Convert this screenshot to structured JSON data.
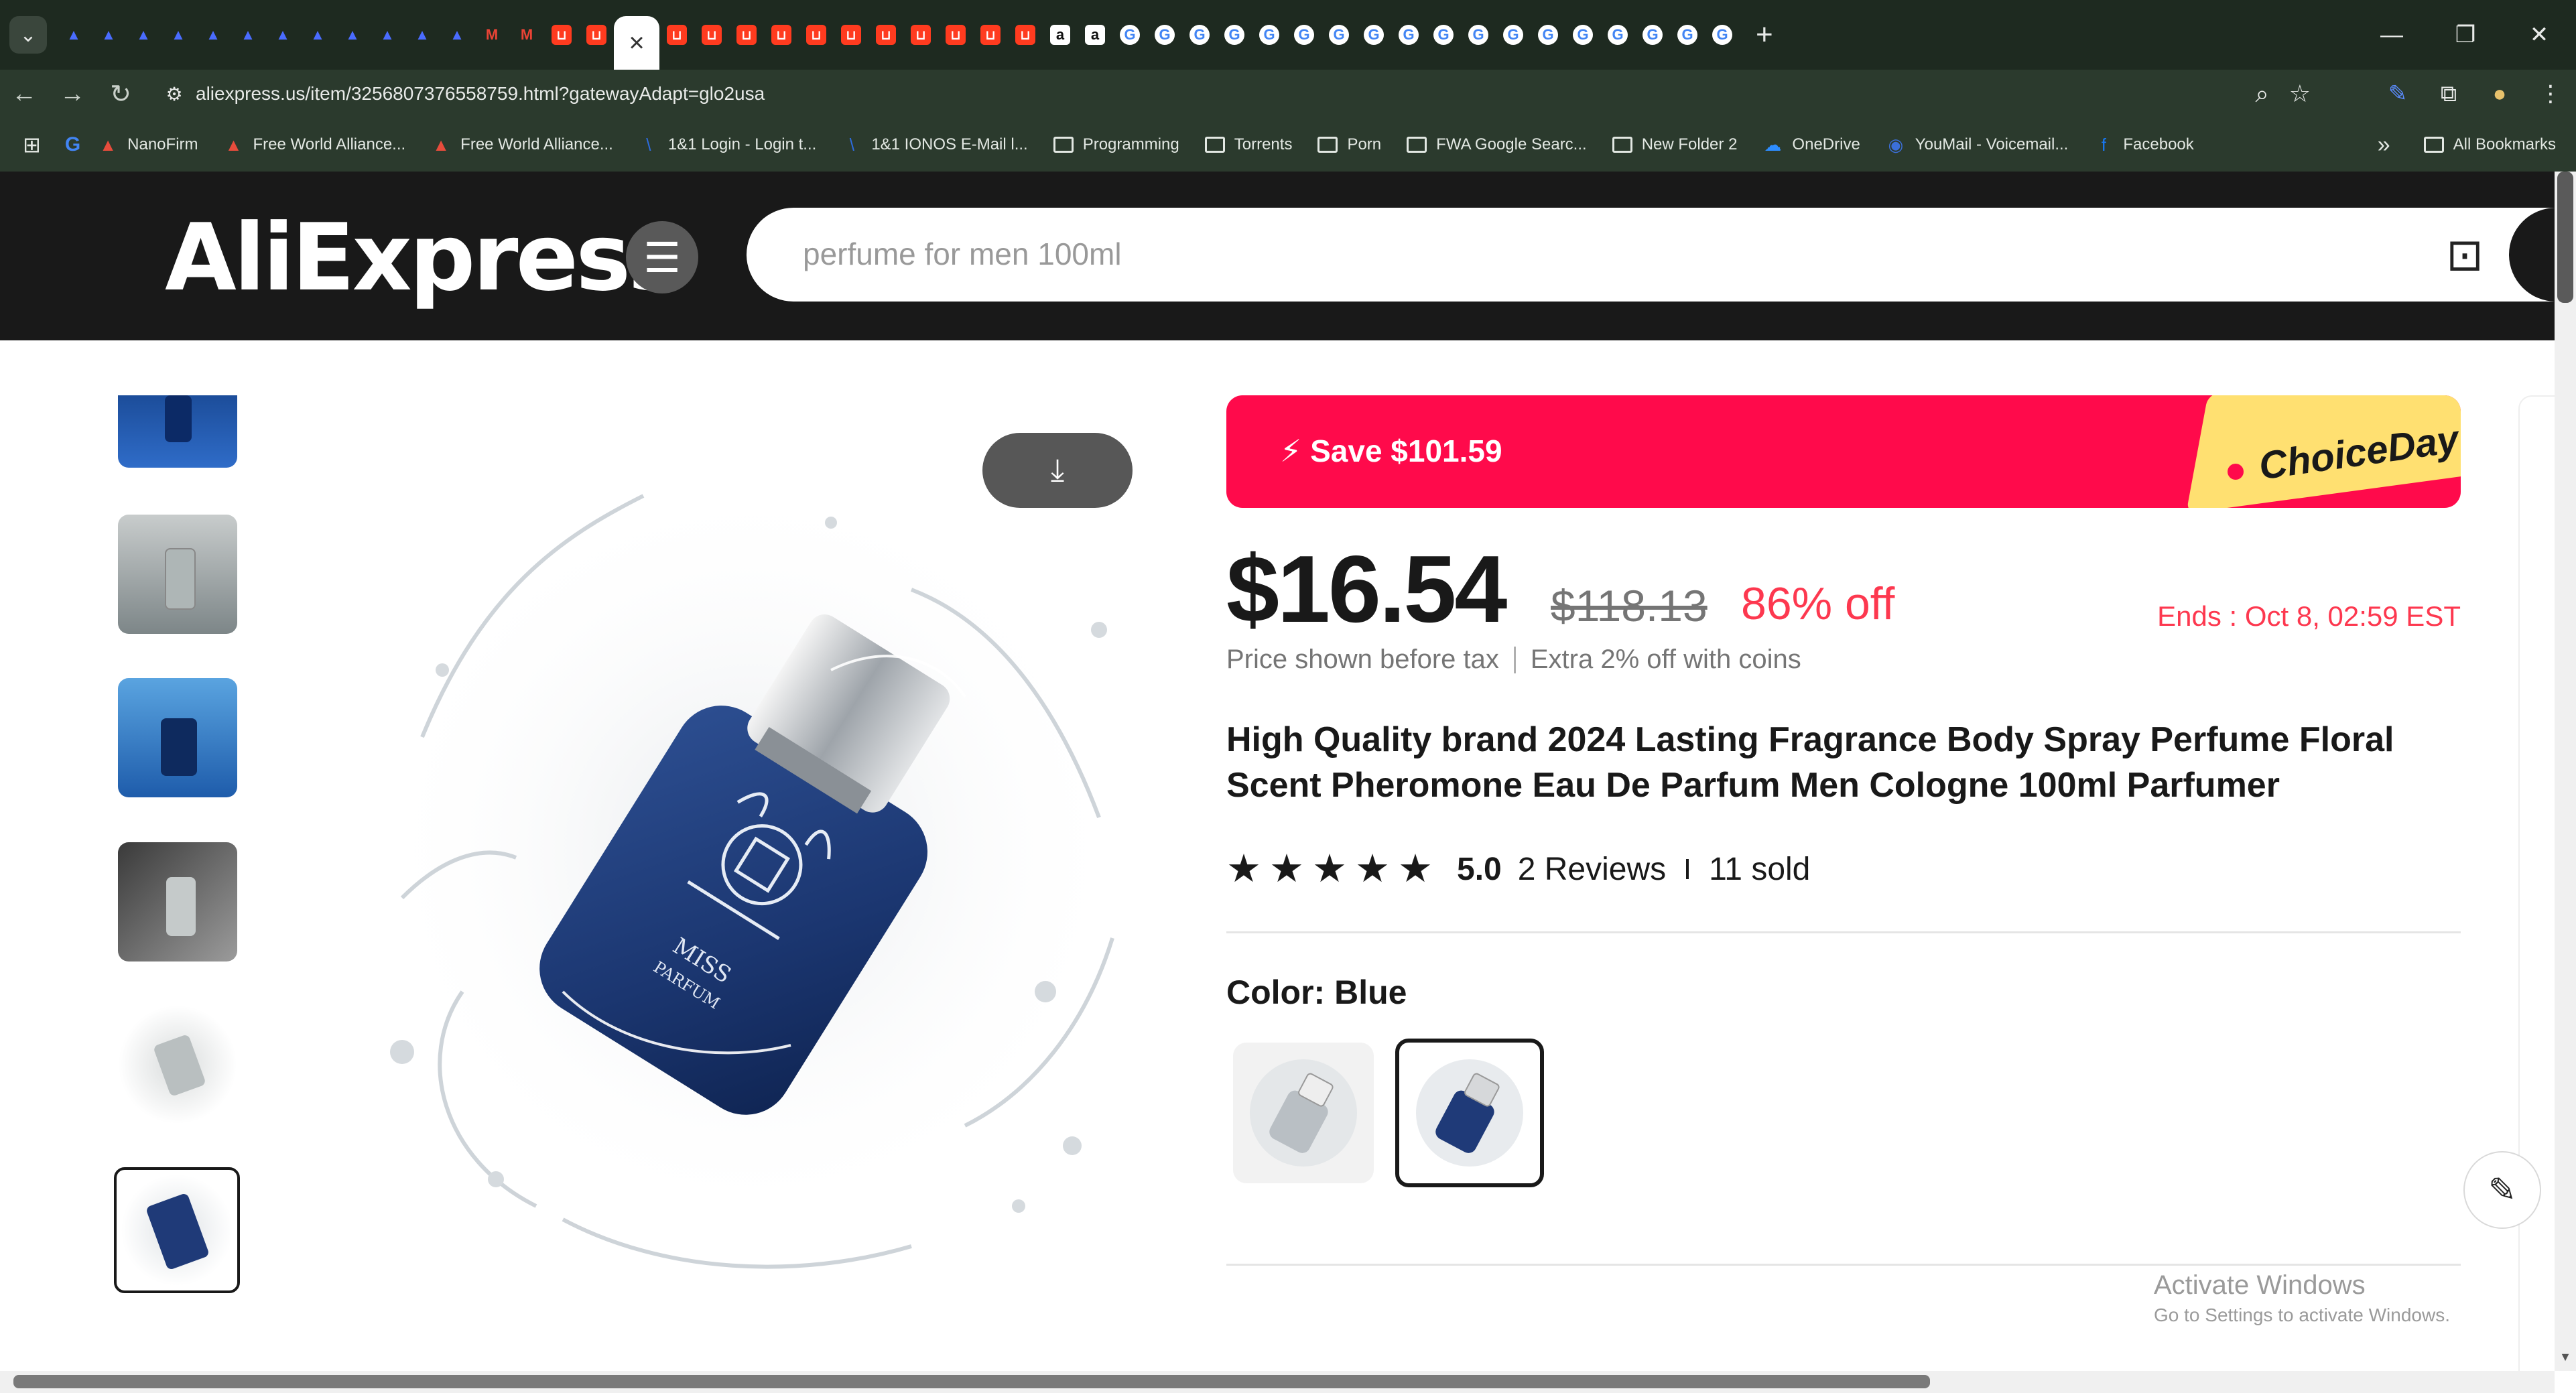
{
  "browser": {
    "tab_count_label": "",
    "new_tab": "+",
    "active_tab_close": "×",
    "url": "aliexpress.us/item/3256807376558759.html?gatewayAdapt=glo2usa",
    "window": {
      "minimize": "—",
      "restore": "❐",
      "close": "✕"
    },
    "tabs": [
      {
        "icon": "ali-blue-icon",
        "color": "#4a6cff"
      },
      {
        "icon": "ali-blue-icon",
        "color": "#4a6cff"
      },
      {
        "icon": "ali-blue-icon",
        "color": "#4a6cff"
      },
      {
        "icon": "ali-blue-icon",
        "color": "#4a6cff"
      },
      {
        "icon": "ali-blue-icon",
        "color": "#4a6cff"
      },
      {
        "icon": "ali-blue-icon",
        "color": "#4a6cff"
      },
      {
        "icon": "ali-blue-icon",
        "color": "#4a6cff"
      },
      {
        "icon": "ali-blue-icon",
        "color": "#4a6cff"
      },
      {
        "icon": "ali-blue-icon",
        "color": "#4a6cff"
      },
      {
        "icon": "ali-blue-icon",
        "color": "#4a6cff"
      },
      {
        "icon": "ali-blue-icon",
        "color": "#4a6cff"
      },
      {
        "icon": "ali-blue-icon",
        "color": "#4a6cff"
      },
      {
        "icon": "gmail-icon",
        "color": "#ea4335"
      },
      {
        "icon": "gmail-icon",
        "color": "#ea4335"
      },
      {
        "icon": "ali-red-icon",
        "color": "#ff3b1f"
      },
      {
        "icon": "ali-red-icon",
        "color": "#ff3b1f"
      },
      {
        "icon": "ali-red-icon",
        "color": "#ff3b1f"
      },
      {
        "icon": "ali-red-icon",
        "color": "#ff3b1f"
      },
      {
        "icon": "ali-red-icon",
        "color": "#ff3b1f"
      },
      {
        "icon": "ali-red-icon",
        "color": "#ff3b1f"
      },
      {
        "icon": "ali-red-icon",
        "color": "#ff3b1f"
      },
      {
        "icon": "ali-red-icon",
        "color": "#ff3b1f"
      },
      {
        "icon": "ali-red-icon",
        "color": "#ff3b1f"
      },
      {
        "icon": "ali-red-icon",
        "color": "#ff3b1f"
      },
      {
        "icon": "ali-red-icon",
        "color": "#ff3b1f"
      },
      {
        "icon": "ali-red-icon",
        "color": "#ff3b1f"
      },
      {
        "icon": "ali-red-icon",
        "color": "#ff3b1f"
      },
      {
        "icon": "amazon-icon",
        "color": "#ffffff"
      },
      {
        "icon": "amazon-icon",
        "color": "#ffffff"
      },
      {
        "icon": "google-icon",
        "color": "#4285f4"
      },
      {
        "icon": "google-icon",
        "color": "#4285f4"
      },
      {
        "icon": "google-icon",
        "color": "#4285f4"
      },
      {
        "icon": "google-icon",
        "color": "#4285f4"
      },
      {
        "icon": "google-icon",
        "color": "#4285f4"
      },
      {
        "icon": "google-icon",
        "color": "#4285f4"
      },
      {
        "icon": "google-icon",
        "color": "#4285f4"
      },
      {
        "icon": "google-icon",
        "color": "#4285f4"
      },
      {
        "icon": "google-icon",
        "color": "#4285f4"
      },
      {
        "icon": "google-icon",
        "color": "#4285f4"
      },
      {
        "icon": "google-icon",
        "color": "#4285f4"
      },
      {
        "icon": "google-icon",
        "color": "#4285f4"
      },
      {
        "icon": "google-icon",
        "color": "#4285f4"
      },
      {
        "icon": "google-icon",
        "color": "#4285f4"
      },
      {
        "icon": "google-icon",
        "color": "#4285f4"
      },
      {
        "icon": "google-icon",
        "color": "#4285f4"
      },
      {
        "icon": "google-icon",
        "color": "#4285f4"
      },
      {
        "icon": "google-icon",
        "color": "#4285f4"
      }
    ]
  },
  "bookmarks": {
    "items": [
      {
        "label": "NanoFirm",
        "type": "site"
      },
      {
        "label": "Free World Alliance...",
        "type": "site"
      },
      {
        "label": "Free World Alliance...",
        "type": "site"
      },
      {
        "label": "1&1 Login - Login t...",
        "type": "site"
      },
      {
        "label": "1&1 IONOS E-Mail l...",
        "type": "site"
      },
      {
        "label": "Programming",
        "type": "folder"
      },
      {
        "label": "Torrents",
        "type": "folder"
      },
      {
        "label": "Porn",
        "type": "folder"
      },
      {
        "label": "FWA Google Searc...",
        "type": "folder"
      },
      {
        "label": "New Folder 2",
        "type": "folder"
      },
      {
        "label": "OneDrive",
        "type": "site"
      },
      {
        "label": "YouMail - Voicemail...",
        "type": "site"
      },
      {
        "label": "Facebook",
        "type": "site"
      }
    ],
    "overflow": "»",
    "all_bookmarks": "All Bookmarks"
  },
  "header": {
    "logo": "AliExpress",
    "search_placeholder": "perfume for men 100ml"
  },
  "product": {
    "promo": {
      "save_text": "Save $101.59",
      "choice_text": "ChoiceDay"
    },
    "price": "$16.54",
    "original_price": "$118.13",
    "discount": "86% off",
    "ends": "Ends :  Oct 8, 02:59 EST",
    "price_note": "Price shown before tax",
    "coins_note": "Extra 2% off with coins",
    "title": "High Quality brand 2024 Lasting Fragrance Body Spray Perfume Floral Scent Pheromone Eau De Parfum Men Cologne 100ml Parfumer",
    "rating": {
      "stars": 5,
      "score": "5.0",
      "reviews": "2 Reviews",
      "sold": "11 sold"
    },
    "color_label": "Color: Blue",
    "selected_color_index": 1
  },
  "system": {
    "activate_title": "Activate Windows",
    "activate_sub": "Go to Settings to activate Windows."
  }
}
